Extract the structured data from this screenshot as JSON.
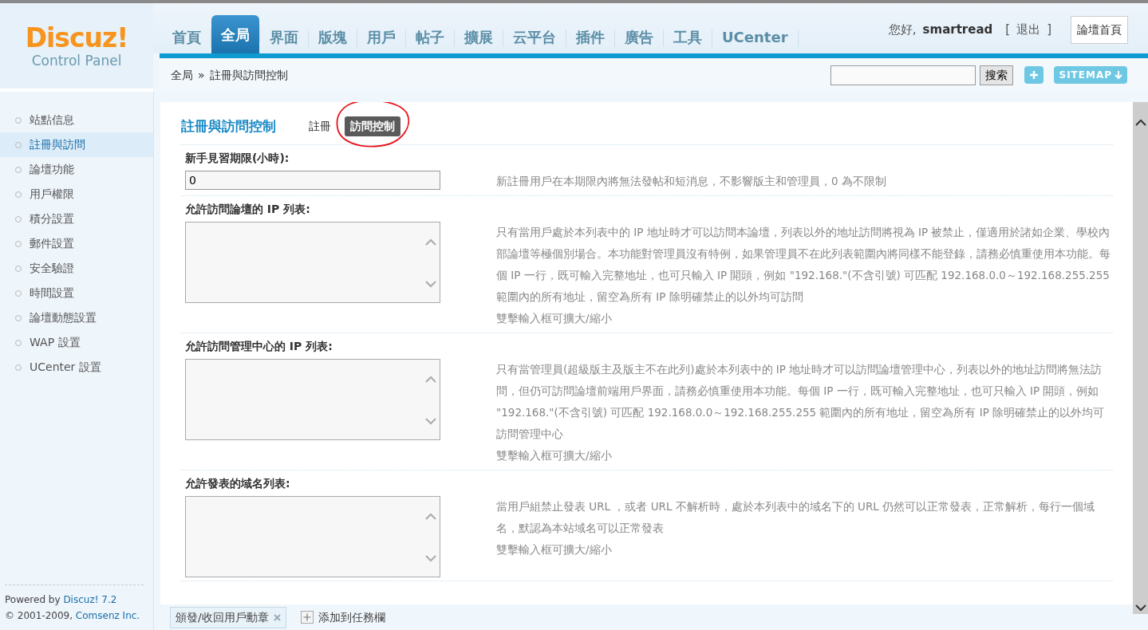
{
  "header": {
    "logo": {
      "title": "Discuz!",
      "subtitle": "Control Panel"
    },
    "nav": [
      {
        "label": "首頁",
        "selected": false
      },
      {
        "label": "全局",
        "selected": true
      },
      {
        "label": "界面",
        "selected": false
      },
      {
        "label": "版塊",
        "selected": false
      },
      {
        "label": "用戶",
        "selected": false
      },
      {
        "label": "帖子",
        "selected": false
      },
      {
        "label": "擴展",
        "selected": false
      },
      {
        "label": "云平台",
        "selected": false
      },
      {
        "label": "插件",
        "selected": false
      },
      {
        "label": "廣告",
        "selected": false
      },
      {
        "label": "工具",
        "selected": false
      },
      {
        "label": "UCenter",
        "selected": false
      }
    ],
    "greeting": "您好,",
    "username": "smartread",
    "bracket_open": "[",
    "logout": "退出",
    "bracket_close": "]",
    "forum_home": "論壇首頁"
  },
  "breadcrumb": {
    "items": [
      "全局",
      "註冊與訪問控制"
    ],
    "separator": "»"
  },
  "search": {
    "button": "搜索"
  },
  "sitemap_button": "SITEMAP",
  "sidebar": {
    "items": [
      {
        "label": "站點信息",
        "selected": false
      },
      {
        "label": "註冊與訪問",
        "selected": true
      },
      {
        "label": "論壇功能",
        "selected": false
      },
      {
        "label": "用戶權限",
        "selected": false
      },
      {
        "label": "積分設置",
        "selected": false
      },
      {
        "label": "郵件設置",
        "selected": false
      },
      {
        "label": "安全驗證",
        "selected": false
      },
      {
        "label": "時間設置",
        "selected": false
      },
      {
        "label": "論壇動態設置",
        "selected": false
      },
      {
        "label": "WAP 設置",
        "selected": false
      },
      {
        "label": "UCenter 設置",
        "selected": false
      }
    ],
    "footer": {
      "powered": "Powered by",
      "product": "Discuz! 7.2",
      "copyright": "© 2001-2009,",
      "company": "Comsenz Inc."
    }
  },
  "page": {
    "title": "註冊與訪問控制",
    "tabs": [
      {
        "label": "註冊",
        "selected": false,
        "circled": false
      },
      {
        "label": "訪問控制",
        "selected": true,
        "circled": true
      }
    ],
    "settings": [
      {
        "kind": "input",
        "label": "新手見習期限(小時):",
        "value": "0",
        "description": "新註冊用戶在本期限內將無法發帖和短消息，不影響版主和管理員，0 為不限制"
      },
      {
        "kind": "textarea",
        "label": "允許訪問論壇的 IP 列表:",
        "description": "只有當用戶處於本列表中的 IP 地址時才可以訪問本論壇，列表以外的地址訪問將視為 IP 被禁止，僅適用於諸如企業、學校內部論壇等極個別場合。本功能對管理員沒有特例，如果管理員不在此列表範圍內將同樣不能登錄，請務必慎重使用本功能。每個 IP 一行，既可輸入完整地址，也可只輸入 IP 開頭，例如 \"192.168.\"(不含引號) 可匹配 192.168.0.0～192.168.255.255 範圍內的所有地址，留空為所有 IP 除明確禁止的以外均可訪問",
        "hint": "雙擊輸入框可擴大/縮小"
      },
      {
        "kind": "textarea",
        "label": "允許訪問管理中心的 IP 列表:",
        "description": "只有當管理員(超級版主及版主不在此列)處於本列表中的 IP 地址時才可以訪問論壇管理中心，列表以外的地址訪問將無法訪問，但仍可訪問論壇前端用戶界面，請務必慎重使用本功能。每個 IP 一行，既可輸入完整地址，也可只輸入 IP 開頭，例如 \"192.168.\"(不含引號) 可匹配 192.168.0.0～192.168.255.255 範圍內的所有地址，留空為所有 IP 除明確禁止的以外均可訪問管理中心",
        "hint": "雙擊輸入框可擴大/縮小"
      },
      {
        "kind": "textarea",
        "label": "允許發表的域名列表:",
        "description": "當用戶組禁止發表 URL ，或者 URL 不解析時，處於本列表中的域名下的 URL 仍然可以正常發表，正常解析，每行一個域名，默認為本站域名可以正常發表",
        "hint": "雙擊輸入框可擴大/縮小"
      }
    ]
  },
  "taskbar": {
    "items": [
      {
        "label": "頒發/收回用戶勳章"
      }
    ],
    "add": "添加到任務欄"
  }
}
